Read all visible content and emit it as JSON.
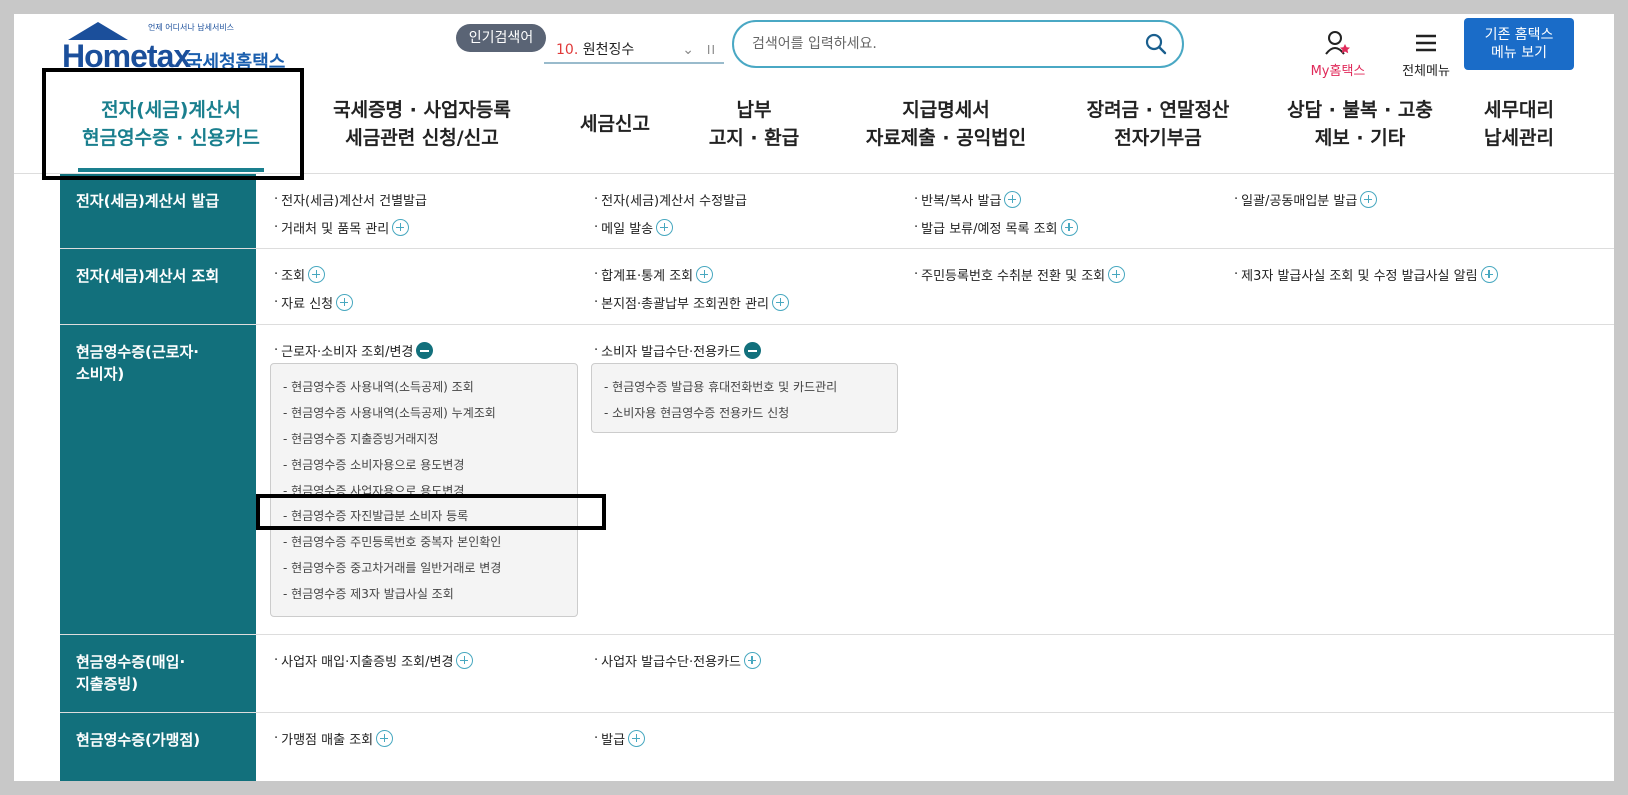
{
  "header": {
    "logo_sub": "언제 어디서나 납세서비스",
    "logo_main": "Hometax",
    "logo_kr": "국세청홈택스",
    "popular_label": "인기검색어",
    "popular_num": "10.",
    "popular_text": "원천징수",
    "popular_pause": "II",
    "search_placeholder": "검색어를 입력하세요.",
    "my_label": "My홈택스",
    "all_menu_label": "전체메뉴",
    "old_btn_line1": "기존 홈택스",
    "old_btn_line2": "메뉴 보기"
  },
  "nav": [
    {
      "line1": "전자(세금)계산서",
      "line2": "현금영수증 · 신용카드"
    },
    {
      "line1": "국세증명 · 사업자등록",
      "line2": "세금관련 신청/신고"
    },
    {
      "line1": "세금신고",
      "line2": ""
    },
    {
      "line1": "납부",
      "line2": "고지 · 환급"
    },
    {
      "line1": "지급명세서",
      "line2": "자료제출 · 공익법인"
    },
    {
      "line1": "장려금 · 연말정산",
      "line2": "전자기부금"
    },
    {
      "line1": "상담 · 불복 · 고충",
      "line2": "제보 · 기타"
    },
    {
      "line1": "세무대리",
      "line2": "납세관리"
    }
  ],
  "rows": [
    {
      "head": "전자(세금)계산서 발급",
      "links": [
        "전자(세금)계산서 건별발급",
        "전자(세금)계산서 수정발급",
        "반복/복사 발급",
        "일괄/공동매입분 발급",
        "거래처 및 품목 관리",
        "메일 발송",
        "발급 보류/예정 목록 조회"
      ]
    },
    {
      "head": "전자(세금)계산서 조회",
      "links": [
        "조회",
        "합계표·통계 조회",
        "주민등록번호 수취분 전환 및 조회",
        "제3자 발급사실 조회 및 수정 발급사실 알림",
        "자료 신청",
        "본지점·총괄납부 조회권한 관리"
      ]
    },
    {
      "head_line1": "현금영수증(근로자·",
      "head_line2": "소비자)",
      "links": [
        "근로자·소비자 조회/변경",
        "소비자 발급수단·전용카드"
      ],
      "panel1": [
        "현금영수증 사용내역(소득공제) 조회",
        "현금영수증 사용내역(소득공제) 누계조회",
        "현금영수증 지출증빙거래지정",
        "현금영수증 소비자용으로 용도변경",
        "현금영수증 사업자용으로 용도변경",
        "현금영수증 자진발급분 소비자 등록",
        "현금영수증 주민등록번호 중복자 본인확인",
        "현금영수증 중고차거래를 일반거래로 변경",
        "현금영수증 제3자 발급사실 조회"
      ],
      "panel2": [
        "현금영수증 발급용 휴대전화번호 및 카드관리",
        "소비자용 현금영수증 전용카드 신청"
      ]
    },
    {
      "head_line1": "현금영수증(매입·",
      "head_line2": "지출증빙)",
      "links": [
        "사업자 매입·지출증빙 조회/변경",
        "사업자 발급수단·전용카드"
      ]
    },
    {
      "head": "현금영수증(가맹점)",
      "links": [
        "가맹점 매출 조회",
        "발급"
      ]
    }
  ]
}
